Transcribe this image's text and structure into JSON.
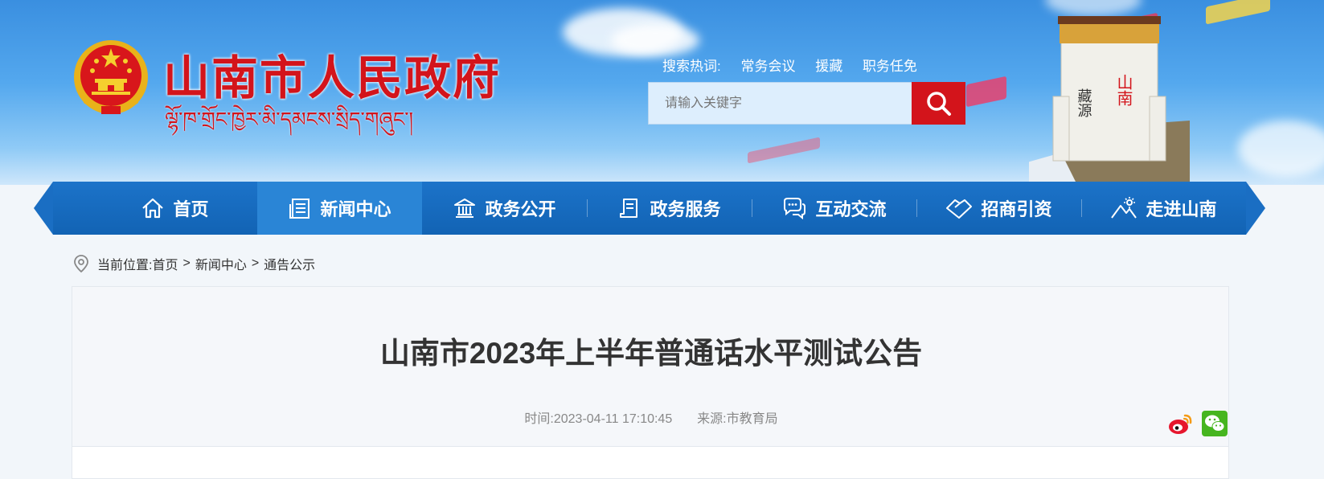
{
  "header": {
    "site_title": "山南市人民政府",
    "site_subtitle_tibetan": "ལྷོ་ཁ་གྲོང་ཁྱེར་མི་དམངས་སྲིད་གཞུང་།",
    "hot_search_label": "搜索热词:",
    "hot_search_terms": [
      "常务会议",
      "援藏",
      "职务任免"
    ],
    "search_placeholder": "请输入关键字",
    "tower_text_left": "藏源",
    "tower_text_right": "山南"
  },
  "nav": {
    "items": [
      {
        "label": "首页",
        "icon": "home-icon"
      },
      {
        "label": "新闻中心",
        "icon": "newspaper-icon",
        "active": true
      },
      {
        "label": "政务公开",
        "icon": "government-building-icon"
      },
      {
        "label": "政务服务",
        "icon": "document-service-icon"
      },
      {
        "label": "互动交流",
        "icon": "chat-bubbles-icon"
      },
      {
        "label": "招商引资",
        "icon": "handshake-icon"
      },
      {
        "label": "走进山南",
        "icon": "mountain-sun-icon"
      }
    ]
  },
  "breadcrumb": {
    "prefix": "当前位置:",
    "items": [
      "首页",
      "新闻中心",
      "通告公示"
    ],
    "separator": ">"
  },
  "article": {
    "title": "山南市2023年上半年普通话水平测试公告",
    "time_label": "时间:",
    "time_value": "2023-04-11 17:10:45",
    "source_label": "来源:",
    "source_value": "市教育局"
  },
  "share": {
    "icons": [
      "weibo-icon",
      "wechat-icon"
    ]
  },
  "colors": {
    "brand_red": "#d3141b",
    "nav_blue": "#1468b9",
    "nav_active": "#2a85d6",
    "banner_sky": "#4a9fe9"
  }
}
